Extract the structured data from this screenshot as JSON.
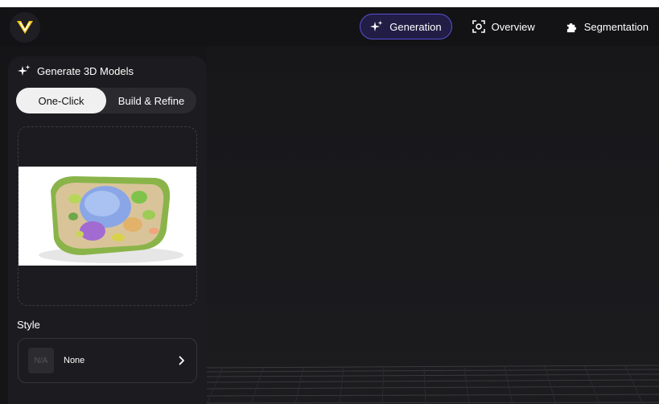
{
  "nav": {
    "tabs": [
      {
        "label": "Generation",
        "icon": "sparkles-icon",
        "active": true
      },
      {
        "label": "Overview",
        "icon": "scan-icon",
        "active": false
      },
      {
        "label": "Segmentation",
        "icon": "puzzle-icon",
        "active": false
      }
    ]
  },
  "panel": {
    "title": "Generate 3D Models",
    "modes": [
      {
        "label": "One-Click",
        "active": true
      },
      {
        "label": "Build & Refine",
        "active": false
      }
    ],
    "upload": {
      "image_subject": "plant cell illustration"
    },
    "style": {
      "label": "Style",
      "thumb_text": "N/A",
      "value": "None"
    }
  },
  "colors": {
    "accent": "#5a4fd6",
    "accent_bg": "#221d45",
    "logo_yellow": "#f5c518"
  }
}
